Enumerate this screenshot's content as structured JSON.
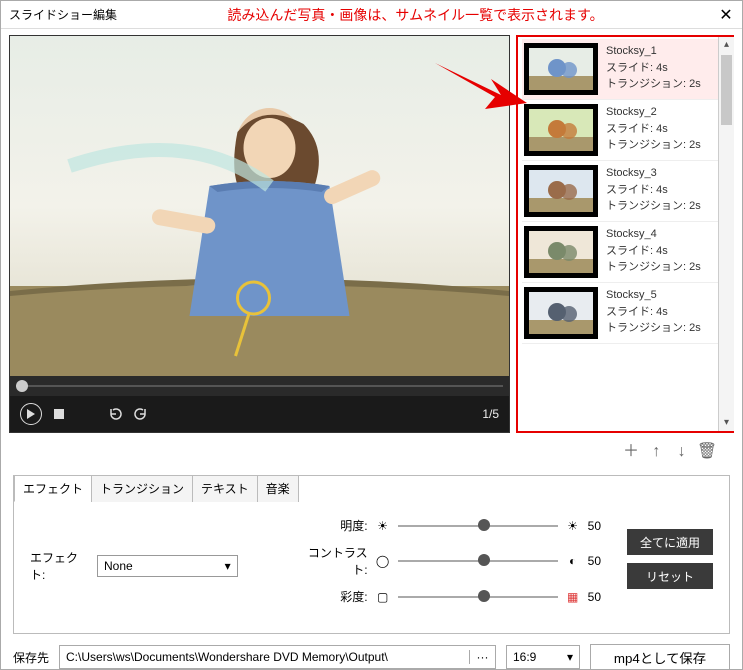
{
  "titlebar": {
    "title": "スライドショー編集",
    "close": "✕"
  },
  "annotation": "読み込んだ写真・画像は、サムネイル一覧で表示されます。",
  "preview": {
    "counter": "1/5"
  },
  "thumbs": {
    "items": [
      {
        "name": "Stocksy_1",
        "slide": "スライド: 4s",
        "trans": "トランジション: 2s",
        "selected": true
      },
      {
        "name": "Stocksy_2",
        "slide": "スライド: 4s",
        "trans": "トランジション: 2s",
        "selected": false
      },
      {
        "name": "Stocksy_3",
        "slide": "スライド: 4s",
        "trans": "トランジション: 2s",
        "selected": false
      },
      {
        "name": "Stocksy_4",
        "slide": "スライド: 4s",
        "trans": "トランジション: 2s",
        "selected": false
      },
      {
        "name": "Stocksy_5",
        "slide": "スライド: 4s",
        "trans": "トランジション: 2s",
        "selected": false
      }
    ]
  },
  "thumb_actions": {
    "add": "＋",
    "up": "↑",
    "down": "↓",
    "delete": "🗑"
  },
  "tabs": {
    "effect": "エフェクト",
    "transition": "トランジション",
    "text": "テキスト",
    "music": "音楽"
  },
  "effect": {
    "label": "エフェクト:",
    "selected": "None",
    "sliders": {
      "brightness": {
        "label": "明度:",
        "value": "50"
      },
      "contrast": {
        "label": "コントラスト:",
        "value": "50"
      },
      "saturation": {
        "label": "彩度:",
        "value": "50"
      }
    },
    "apply_all": "全てに適用",
    "reset": "リセット"
  },
  "save": {
    "label": "保存先",
    "path": "C:\\Users\\ws\\Documents\\Wondershare DVD Memory\\Output\\",
    "aspect": "16:9",
    "button": "mp4として保存"
  }
}
